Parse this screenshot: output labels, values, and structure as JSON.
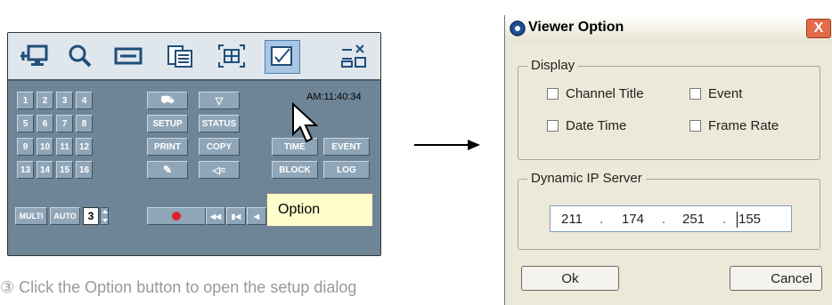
{
  "viewer": {
    "toolbar_icons": [
      "network-icon",
      "search-icon",
      "display-icon",
      "files-icon",
      "fullscreen-icon",
      "option-icon",
      "minimize-close-icon"
    ],
    "time": "AM:11:40:34",
    "channels": [
      "1",
      "2",
      "3",
      "4",
      "5",
      "6",
      "7",
      "8",
      "9",
      "10",
      "11",
      "12",
      "13",
      "14",
      "15",
      "16"
    ],
    "buttons": {
      "setup": "SETUP",
      "status": "STATUS",
      "print": "PRINT",
      "copy": "COPY",
      "time": "TIME",
      "event": "EVENT",
      "block": "BLOCK",
      "log": "LOG",
      "multi": "MULTI",
      "auto": "AUTO"
    },
    "stepper_value": "3",
    "tooltip": "Option",
    "colors": {
      "panel": "#6d8597",
      "toolbar": "#dfe6ec",
      "record": "#e0202a"
    }
  },
  "caption": "③ Click the Option button to open the setup dialog",
  "dialog": {
    "title": "Viewer Option",
    "close_label": "X",
    "display_group": {
      "label": "Display",
      "options": [
        "Channel Title",
        "Event",
        "Date Time",
        "Frame Rate"
      ]
    },
    "dynamic_ip_group": {
      "label": "Dynamic IP Server",
      "octets": [
        "211",
        "174",
        "251",
        "155"
      ]
    },
    "ok_label": "Ok",
    "cancel_label": "Cancel"
  }
}
